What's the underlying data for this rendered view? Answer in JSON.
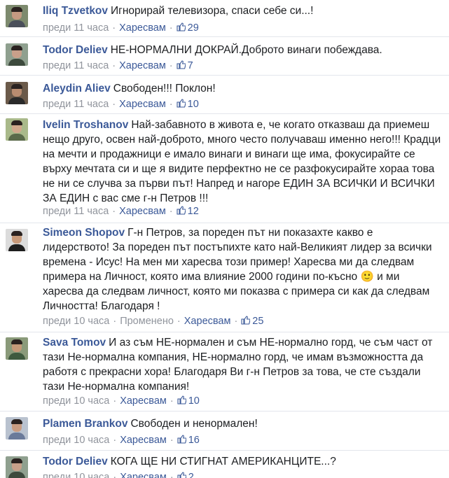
{
  "comments": [
    {
      "author": "Iliq Tzvetkov",
      "text": "Игнорирай телевизора, спаси себе си...!",
      "time": "преди 11 часа",
      "edited": "",
      "like": "Харесвам",
      "likes": "29",
      "avatar_bg": "#7d8a6e"
    },
    {
      "author": "Todor Deliev",
      "text": "НЕ-НОРМАЛНИ ДОКРАЙ.Доброто винаги побеждава.",
      "time": "преди 11 часа",
      "edited": "",
      "like": "Харесвам",
      "likes": "7",
      "avatar_bg": "#8fa08f"
    },
    {
      "author": "Aleydin Aliev",
      "text": "Свободен!!! Поклон!",
      "time": "преди 11 часа",
      "edited": "",
      "like": "Харесвам",
      "likes": "10",
      "avatar_bg": "#6b5a4a"
    },
    {
      "author": "Ivelin Troshanov",
      "text": "Най-забавното в живота е, че когато отказваш да приемеш нещо друго, освен най-доброто, много често получаваш именно него!!! Крадци на мечти и продажници е имало винаги и винаги ще има, фокусирайте се върху мечтата си и ще я видите перфектно не се разфокусирайте хораа това не ни се случва за първи път! Напред и нагоре ЕДИН ЗА ВСИЧКИ И ВСИЧКИ ЗА ЕДИН с вас сме г-н Петров !!!",
      "time": "преди 11 часа",
      "edited": "",
      "like": "Харесвам",
      "likes": "12",
      "avatar_bg": "#a9b98a"
    },
    {
      "author": "Simeon Shopov",
      "text": "Г-н Петров, за пореден път ни показахте какво е лидерството! За пореден път постъпихте като най-Великият лидер за всички времена - Исус! На мен ми харесва този пример! Харесва ми да следвам примера на Личност, която има влияние 2000 години по-късно 🙂 и ми харесва да следвам личност, която ми показва с примера си как да следвам Личността! Благодаря !",
      "time": "преди 10 часа",
      "edited": "Променено",
      "like": "Харесвам",
      "likes": "25",
      "avatar_bg": "#dcdcdc"
    },
    {
      "author": "Sava Tomov",
      "text": "И аз съм НЕ-нормален и съм НЕ-нормално горд, че съм част от тази Не-нормална компания, НЕ-нормално горд, че имам възможността да работя с прекрасни хора! Благодаря Ви г-н Петров за това, че сте създали тази Не-нормална компания!",
      "time": "преди 10 часа",
      "edited": "",
      "like": "Харесвам",
      "likes": "10",
      "avatar_bg": "#8a9a7a"
    },
    {
      "author": "Plamen Brankov",
      "text": "Свободен и ненормален!",
      "time": "преди 10 часа",
      "edited": "",
      "like": "Харесвам",
      "likes": "16",
      "avatar_bg": "#b9c2cf"
    },
    {
      "author": "Todor Deliev",
      "text": "КОГА ЩЕ НИ СТИГНАТ АМЕРИКАНЦИТЕ...?",
      "time": "преди 10 часа",
      "edited": "",
      "like": "Харесвам",
      "likes": "2",
      "avatar_bg": "#8fa08f"
    }
  ]
}
